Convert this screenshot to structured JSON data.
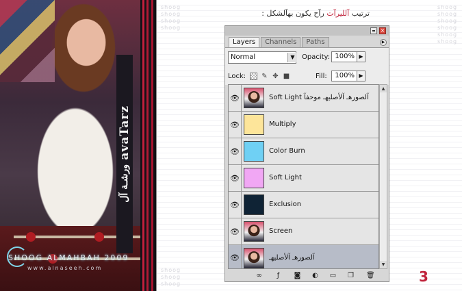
{
  "banner": {
    "brand_latin": "avaTarz",
    "brand_arabic": "ورشـة آل",
    "signature": "SHOOG ALMAHBAH 2009",
    "url": "www.alnaseeh.com"
  },
  "content": {
    "caption_prefix": "ترتيب",
    "caption_highlight": "آلليرآت",
    "caption_suffix": "رآح يكون بهآلشكل :",
    "step_number": "3",
    "watermark": "shoog",
    "accent_color": "#c0243c"
  },
  "panel": {
    "tabs": [
      {
        "label": "Layers",
        "active": true
      },
      {
        "label": "Channels",
        "active": false
      },
      {
        "label": "Paths",
        "active": false
      }
    ],
    "blend_mode": "Normal",
    "opacity_label": "Opacity:",
    "opacity_value": "100%",
    "lock_label": "Lock:",
    "fill_label": "Fill:",
    "fill_value": "100%",
    "layers": [
      {
        "name": "Soft Light آلصورهـ آلأصليهـ موحفآ",
        "thumb": "photo",
        "selected": false
      },
      {
        "name": "Multiply",
        "thumb": "#fde59a",
        "selected": false
      },
      {
        "name": "Color Burn",
        "thumb": "#6fd0f4",
        "selected": false
      },
      {
        "name": "Soft Light",
        "thumb": "#f1a7f4",
        "selected": false
      },
      {
        "name": "Exclusion",
        "thumb": "#0f2335",
        "selected": false
      },
      {
        "name": "Screen",
        "thumb": "photo",
        "selected": false
      },
      {
        "name": "آلصورهـ آلأصليهـ",
        "thumb": "photo",
        "selected": true
      }
    ],
    "footer_icons": [
      "link-icon",
      "layer-style-icon",
      "mask-icon",
      "adjustment-icon",
      "group-icon",
      "new-layer-icon",
      "trash-icon"
    ]
  }
}
